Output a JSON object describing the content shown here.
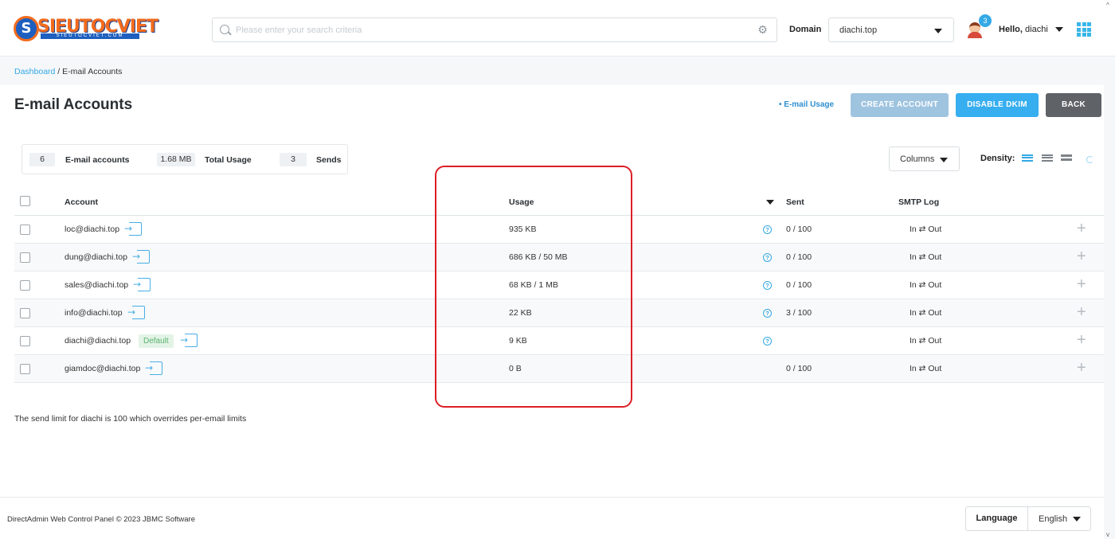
{
  "brand": {
    "logo_text": "SIEUTOCVIET",
    "logo_sub": "SIEUTOCVIET.COM",
    "logo_letter": "S"
  },
  "search": {
    "placeholder": "Please enter your search criteria",
    "value": ""
  },
  "header": {
    "domain_label": "Domain",
    "domain_value": "diachi.top",
    "notification_count": "3",
    "hello_prefix": "Hello,",
    "username": "diachi"
  },
  "breadcrumb": {
    "home": "Dashboard",
    "separator": "/",
    "current": "E-mail Accounts"
  },
  "page": {
    "title": "E-mail Accounts",
    "usage_link": "• E-mail Usage",
    "buttons": {
      "create": "CREATE ACCOUNT",
      "disable_dkim": "DISABLE DKIM",
      "back": "BACK"
    }
  },
  "stats": [
    {
      "value": "6",
      "label": "E-mail accounts"
    },
    {
      "value": "1.68 MB",
      "label": "Total Usage"
    },
    {
      "value": "3",
      "label": "Sends"
    }
  ],
  "toolbar": {
    "columns_label": "Columns",
    "density_label": "Density:"
  },
  "table": {
    "headers": {
      "account": "Account",
      "usage": "Usage",
      "sent": "Sent",
      "smtp_log": "SMTP Log"
    },
    "rows": [
      {
        "account": "loc@diachi.top",
        "default": "",
        "usage": "935 KB",
        "sent": "0 / 100",
        "smtp": "In ⇄ Out",
        "help": true
      },
      {
        "account": "dung@diachi.top",
        "default": "",
        "usage": "686 KB / 50 MB",
        "sent": "0 / 100",
        "smtp": "In ⇄ Out",
        "help": true
      },
      {
        "account": "sales@diachi.top",
        "default": "",
        "usage": "68 KB / 1 MB",
        "sent": "0 / 100",
        "smtp": "In ⇄ Out",
        "help": true
      },
      {
        "account": "info@diachi.top",
        "default": "",
        "usage": "22 KB",
        "sent": "3 / 100",
        "smtp": "In ⇄ Out",
        "help": true
      },
      {
        "account": "diachi@diachi.top",
        "default": "Default",
        "usage": "9 KB",
        "sent": "",
        "smtp": "In ⇄ Out",
        "help": true
      },
      {
        "account": "giamdoc@diachi.top",
        "default": "",
        "usage": "0 B",
        "sent": "0 / 100",
        "smtp": "In ⇄ Out",
        "help": false
      }
    ]
  },
  "footnote": "The send limit for diachi is 100 which overrides per-email limits",
  "footer": {
    "copyright": "DirectAdmin Web Control Panel © 2023 JBMC Software",
    "language_label": "Language",
    "language_value": "English"
  },
  "colors": {
    "accent": "#34a9e6",
    "highlight": "#dc1f26",
    "brand_orange": "#f26b1d",
    "brand_blue": "#1e5fbf"
  }
}
